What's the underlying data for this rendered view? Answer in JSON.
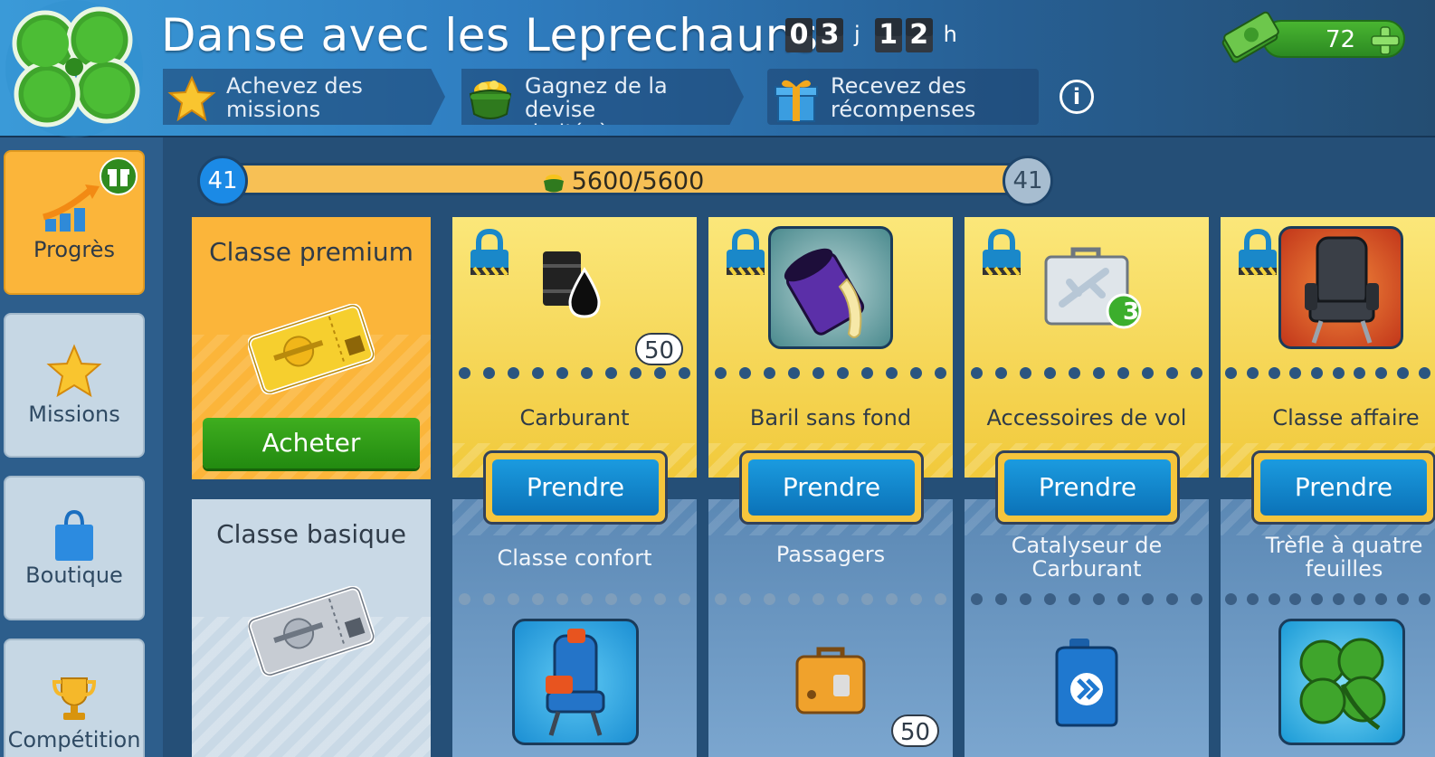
{
  "header": {
    "title": "Danse avec les Leprechauns",
    "timer": {
      "days_digits": [
        "0",
        "3"
      ],
      "days_unit": "j",
      "hours_digits": [
        "1",
        "2"
      ],
      "hours_unit": "h"
    },
    "steps": [
      {
        "label_line1": "Achevez des",
        "label_line2": "missions",
        "icon": "star-icon"
      },
      {
        "label_line1": "Gagnez de la devise",
        "label_line2": "de l'évènement",
        "icon": "pot-of-gold-icon"
      },
      {
        "label_line1": "Recevez des",
        "label_line2": "récompenses",
        "icon": "gift-icon"
      }
    ],
    "info_label": "i",
    "cash": {
      "value": "72",
      "icon": "cash-icon",
      "plus_icon": "plus-icon"
    }
  },
  "sidebar": {
    "items": [
      {
        "label": "Progrès",
        "icon": "progress-chart-icon",
        "active": true
      },
      {
        "label": "Missions",
        "icon": "star-icon",
        "active": false
      },
      {
        "label": "Boutique",
        "icon": "shopping-bag-icon",
        "active": false
      },
      {
        "label": "Compétition",
        "icon": "trophy-icon",
        "active": false
      }
    ]
  },
  "progress": {
    "level_current": "41",
    "level_next": "41",
    "text": "5600/5600",
    "fraction": 1.0
  },
  "classes": {
    "premium": {
      "title": "Classe premium",
      "buy_label": "Acheter"
    },
    "basic": {
      "title": "Classe basique"
    }
  },
  "rewards": [
    {
      "premium_name": "Carburant",
      "premium_icon": "oil-barrel-icon",
      "premium_qty": "50",
      "take_label": "Prendre",
      "basic_name_line1": "Classe confort",
      "basic_name_line2": "",
      "basic_icon": "comfort-seat-icon",
      "basic_qty": ""
    },
    {
      "premium_name": "Baril sans fond",
      "premium_icon": "bottomless-barrel-icon",
      "premium_qty": "",
      "take_label": "Prendre",
      "basic_name_line1": "Passagers",
      "basic_name_line2": "",
      "basic_icon": "suitcase-icon",
      "basic_qty": "50"
    },
    {
      "premium_name": "Accessoires de vol",
      "premium_icon": "flight-kit-icon",
      "premium_badge": "3",
      "take_label": "Prendre",
      "basic_name_line1": "Catalyseur de",
      "basic_name_line2": "Carburant",
      "basic_icon": "fuel-catalyst-icon",
      "basic_qty": ""
    },
    {
      "premium_name": "Classe affaire",
      "premium_icon": "business-seat-icon",
      "premium_qty": "",
      "take_label": "Prendre",
      "basic_name_line1": "Trèfle à quatre",
      "basic_name_line2": "feuilles",
      "basic_icon": "four-leaf-clover-icon",
      "basic_qty": ""
    }
  ],
  "colors": {
    "premium": "#fbb53a",
    "take_button": "#0b8fd3",
    "buy_button": "#2a9a16",
    "progress_fill": "#f5b34a"
  }
}
